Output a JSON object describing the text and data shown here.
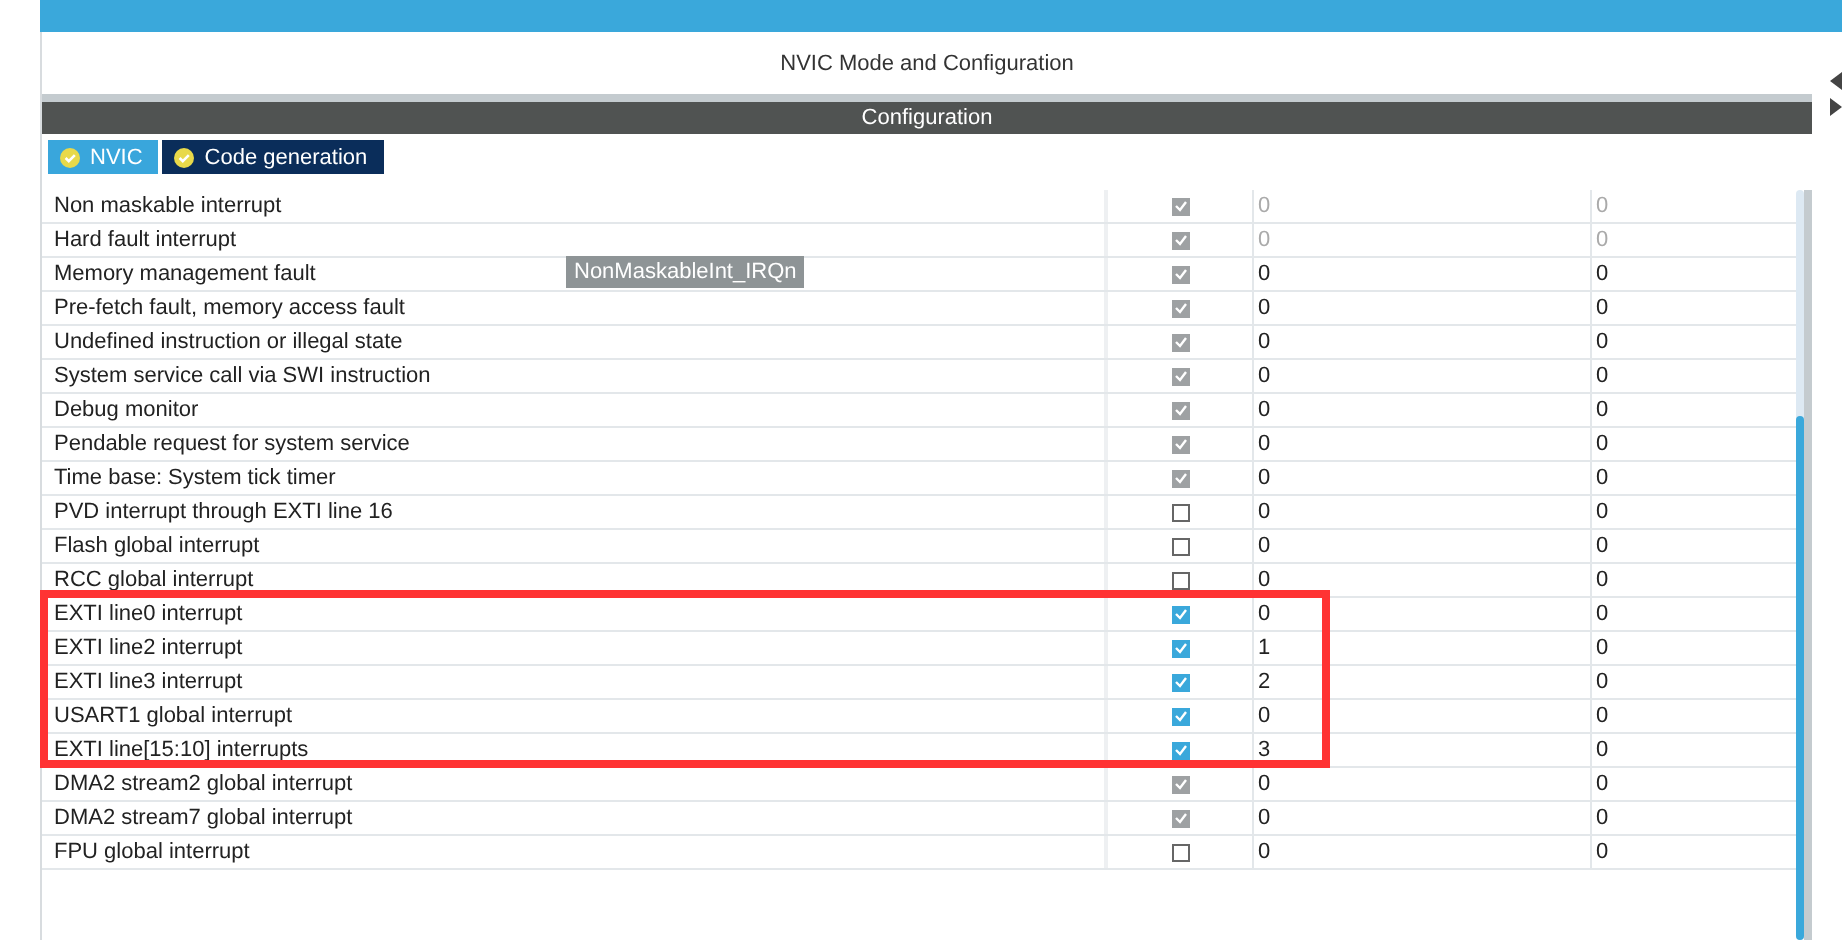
{
  "panel": {
    "title": "NVIC Mode and Configuration",
    "section": "Configuration"
  },
  "tabs": [
    {
      "label": "NVIC",
      "selected": false
    },
    {
      "label": "Code generation",
      "selected": true
    }
  ],
  "tooltip": "NonMaskableInt_IRQn",
  "table": {
    "rows": [
      {
        "name": "Non maskable interrupt",
        "kind": "fixed",
        "checked": true,
        "priority": "0",
        "sub_priority": "0",
        "dimmed": true,
        "highlighted": false
      },
      {
        "name": "Hard fault interrupt",
        "kind": "fixed",
        "checked": true,
        "priority": "0",
        "sub_priority": "0",
        "dimmed": true,
        "highlighted": false
      },
      {
        "name": "Memory management fault",
        "kind": "fixed",
        "checked": true,
        "priority": "0",
        "sub_priority": "0",
        "dimmed": false,
        "highlighted": false
      },
      {
        "name": "Pre-fetch fault, memory access fault",
        "kind": "fixed",
        "checked": true,
        "priority": "0",
        "sub_priority": "0",
        "dimmed": false,
        "highlighted": false
      },
      {
        "name": "Undefined instruction or illegal state",
        "kind": "fixed",
        "checked": true,
        "priority": "0",
        "sub_priority": "0",
        "dimmed": false,
        "highlighted": false
      },
      {
        "name": "System service call via SWI instruction",
        "kind": "fixed",
        "checked": true,
        "priority": "0",
        "sub_priority": "0",
        "dimmed": false,
        "highlighted": false
      },
      {
        "name": "Debug monitor",
        "kind": "fixed",
        "checked": true,
        "priority": "0",
        "sub_priority": "0",
        "dimmed": false,
        "highlighted": false
      },
      {
        "name": "Pendable request for system service",
        "kind": "fixed",
        "checked": true,
        "priority": "0",
        "sub_priority": "0",
        "dimmed": false,
        "highlighted": false
      },
      {
        "name": "Time base: System tick timer",
        "kind": "fixed",
        "checked": true,
        "priority": "0",
        "sub_priority": "0",
        "dimmed": false,
        "highlighted": false
      },
      {
        "name": "PVD interrupt through EXTI line 16",
        "kind": "optional",
        "checked": false,
        "priority": "0",
        "sub_priority": "0",
        "dimmed": false,
        "highlighted": false
      },
      {
        "name": "Flash global interrupt",
        "kind": "optional",
        "checked": false,
        "priority": "0",
        "sub_priority": "0",
        "dimmed": false,
        "highlighted": false
      },
      {
        "name": "RCC global interrupt",
        "kind": "optional",
        "checked": false,
        "priority": "0",
        "sub_priority": "0",
        "dimmed": false,
        "highlighted": false
      },
      {
        "name": "EXTI line0 interrupt",
        "kind": "optional",
        "checked": true,
        "priority": "0",
        "sub_priority": "0",
        "dimmed": false,
        "highlighted": true
      },
      {
        "name": "EXTI line2 interrupt",
        "kind": "optional",
        "checked": true,
        "priority": "1",
        "sub_priority": "0",
        "dimmed": false,
        "highlighted": true
      },
      {
        "name": "EXTI line3 interrupt",
        "kind": "optional",
        "checked": true,
        "priority": "2",
        "sub_priority": "0",
        "dimmed": false,
        "highlighted": true
      },
      {
        "name": "USART1 global interrupt",
        "kind": "optional",
        "checked": true,
        "priority": "0",
        "sub_priority": "0",
        "dimmed": false,
        "highlighted": true
      },
      {
        "name": "EXTI line[15:10] interrupts",
        "kind": "optional",
        "checked": true,
        "priority": "3",
        "sub_priority": "0",
        "dimmed": false,
        "highlighted": true
      },
      {
        "name": "DMA2 stream2 global interrupt",
        "kind": "fixed",
        "checked": true,
        "priority": "0",
        "sub_priority": "0",
        "dimmed": false,
        "highlighted": false
      },
      {
        "name": "DMA2 stream7 global interrupt",
        "kind": "fixed",
        "checked": true,
        "priority": "0",
        "sub_priority": "0",
        "dimmed": false,
        "highlighted": false
      },
      {
        "name": "FPU global interrupt",
        "kind": "optional",
        "checked": false,
        "priority": "0",
        "sub_priority": "0",
        "dimmed": false,
        "highlighted": false
      }
    ]
  }
}
